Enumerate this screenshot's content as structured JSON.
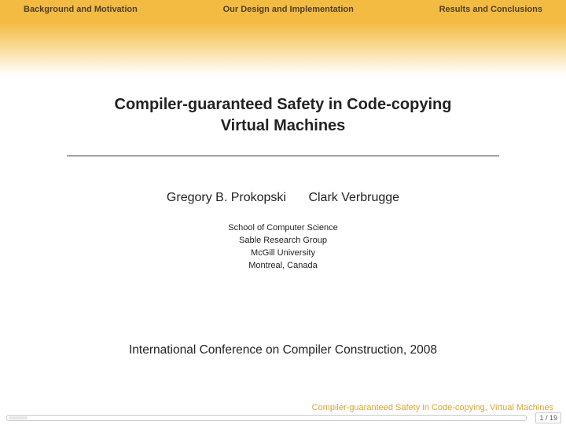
{
  "nav": {
    "items": [
      "Background and Motivation",
      "Our Design and Implementation",
      "Results and Conclusions"
    ]
  },
  "title": {
    "line1": "Compiler-guaranteed Safety in Code-copying",
    "line2": "Virtual Machines"
  },
  "authors": {
    "a1": "Gregory B. Prokopski",
    "a2": "Clark Verbrugge"
  },
  "affiliation": {
    "l1": "School of Computer Science",
    "l2": "Sable Research Group",
    "l3": "McGill University",
    "l4": "Montreal, Canada"
  },
  "venue": "International Conference on Compiler Construction, 2008",
  "footer": {
    "short_title": "Compiler-guaranteed Safety in Code-copying, Virtual Machines",
    "page": "1 / 19"
  }
}
